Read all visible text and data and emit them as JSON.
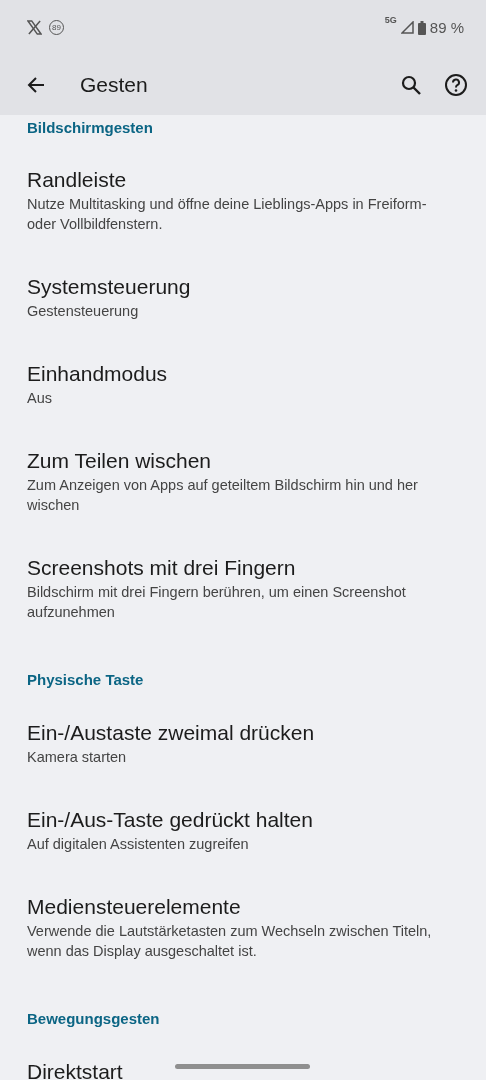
{
  "status_bar": {
    "notification_badge": "89",
    "network": "5G",
    "battery": "89 %"
  },
  "app_bar": {
    "title": "Gesten"
  },
  "sections": [
    {
      "header": "Bildschirmgesten",
      "items": [
        {
          "title": "Randleiste",
          "subtitle": "Nutze Multitasking und öffne deine Lieblings-Apps in Freiform- oder Vollbildfenstern."
        },
        {
          "title": "Systemsteuerung",
          "subtitle": "Gestensteuerung"
        },
        {
          "title": "Einhandmodus",
          "subtitle": "Aus"
        },
        {
          "title": "Zum Teilen wischen",
          "subtitle": "Zum Anzeigen von Apps auf geteiltem Bildschirm hin und her wischen"
        },
        {
          "title": "Screenshots mit drei Fingern",
          "subtitle": "Bildschirm mit drei Fingern berühren, um einen Screenshot aufzunehmen"
        }
      ]
    },
    {
      "header": "Physische Taste",
      "items": [
        {
          "title": "Ein-/Austaste zweimal drücken",
          "subtitle": "Kamera starten"
        },
        {
          "title": "Ein-/Aus-Taste gedrückt halten",
          "subtitle": "Auf digitalen Assistenten zugreifen"
        },
        {
          "title": "Mediensteuerelemente",
          "subtitle": "Verwende die Lautstärketasten zum Wechseln zwischen Titeln, wenn das Display ausgeschaltet ist."
        }
      ]
    },
    {
      "header": "Bewegungsgesten",
      "items": [
        {
          "title": "Direktstart"
        }
      ]
    }
  ]
}
